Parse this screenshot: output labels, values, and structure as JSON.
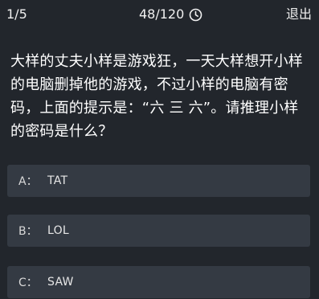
{
  "header": {
    "progress": "1/5",
    "timer": "48/120",
    "timer_icon": "clock-icon",
    "exit_label": "退出"
  },
  "question": {
    "text": "大样的丈夫小样是游戏狂，一天大样想开小样的电脑删掉他的游戏，不过小样的电脑有密码，上面的提示是：“六 三 六”。请推理小样的密码是什么？"
  },
  "options": [
    {
      "letter": "A：",
      "text": "TAT"
    },
    {
      "letter": "B：",
      "text": "LOL"
    },
    {
      "letter": "C：",
      "text": "SAW"
    }
  ],
  "colors": {
    "background": "#22262c",
    "option_background": "#343a43",
    "text": "#ffffff"
  }
}
